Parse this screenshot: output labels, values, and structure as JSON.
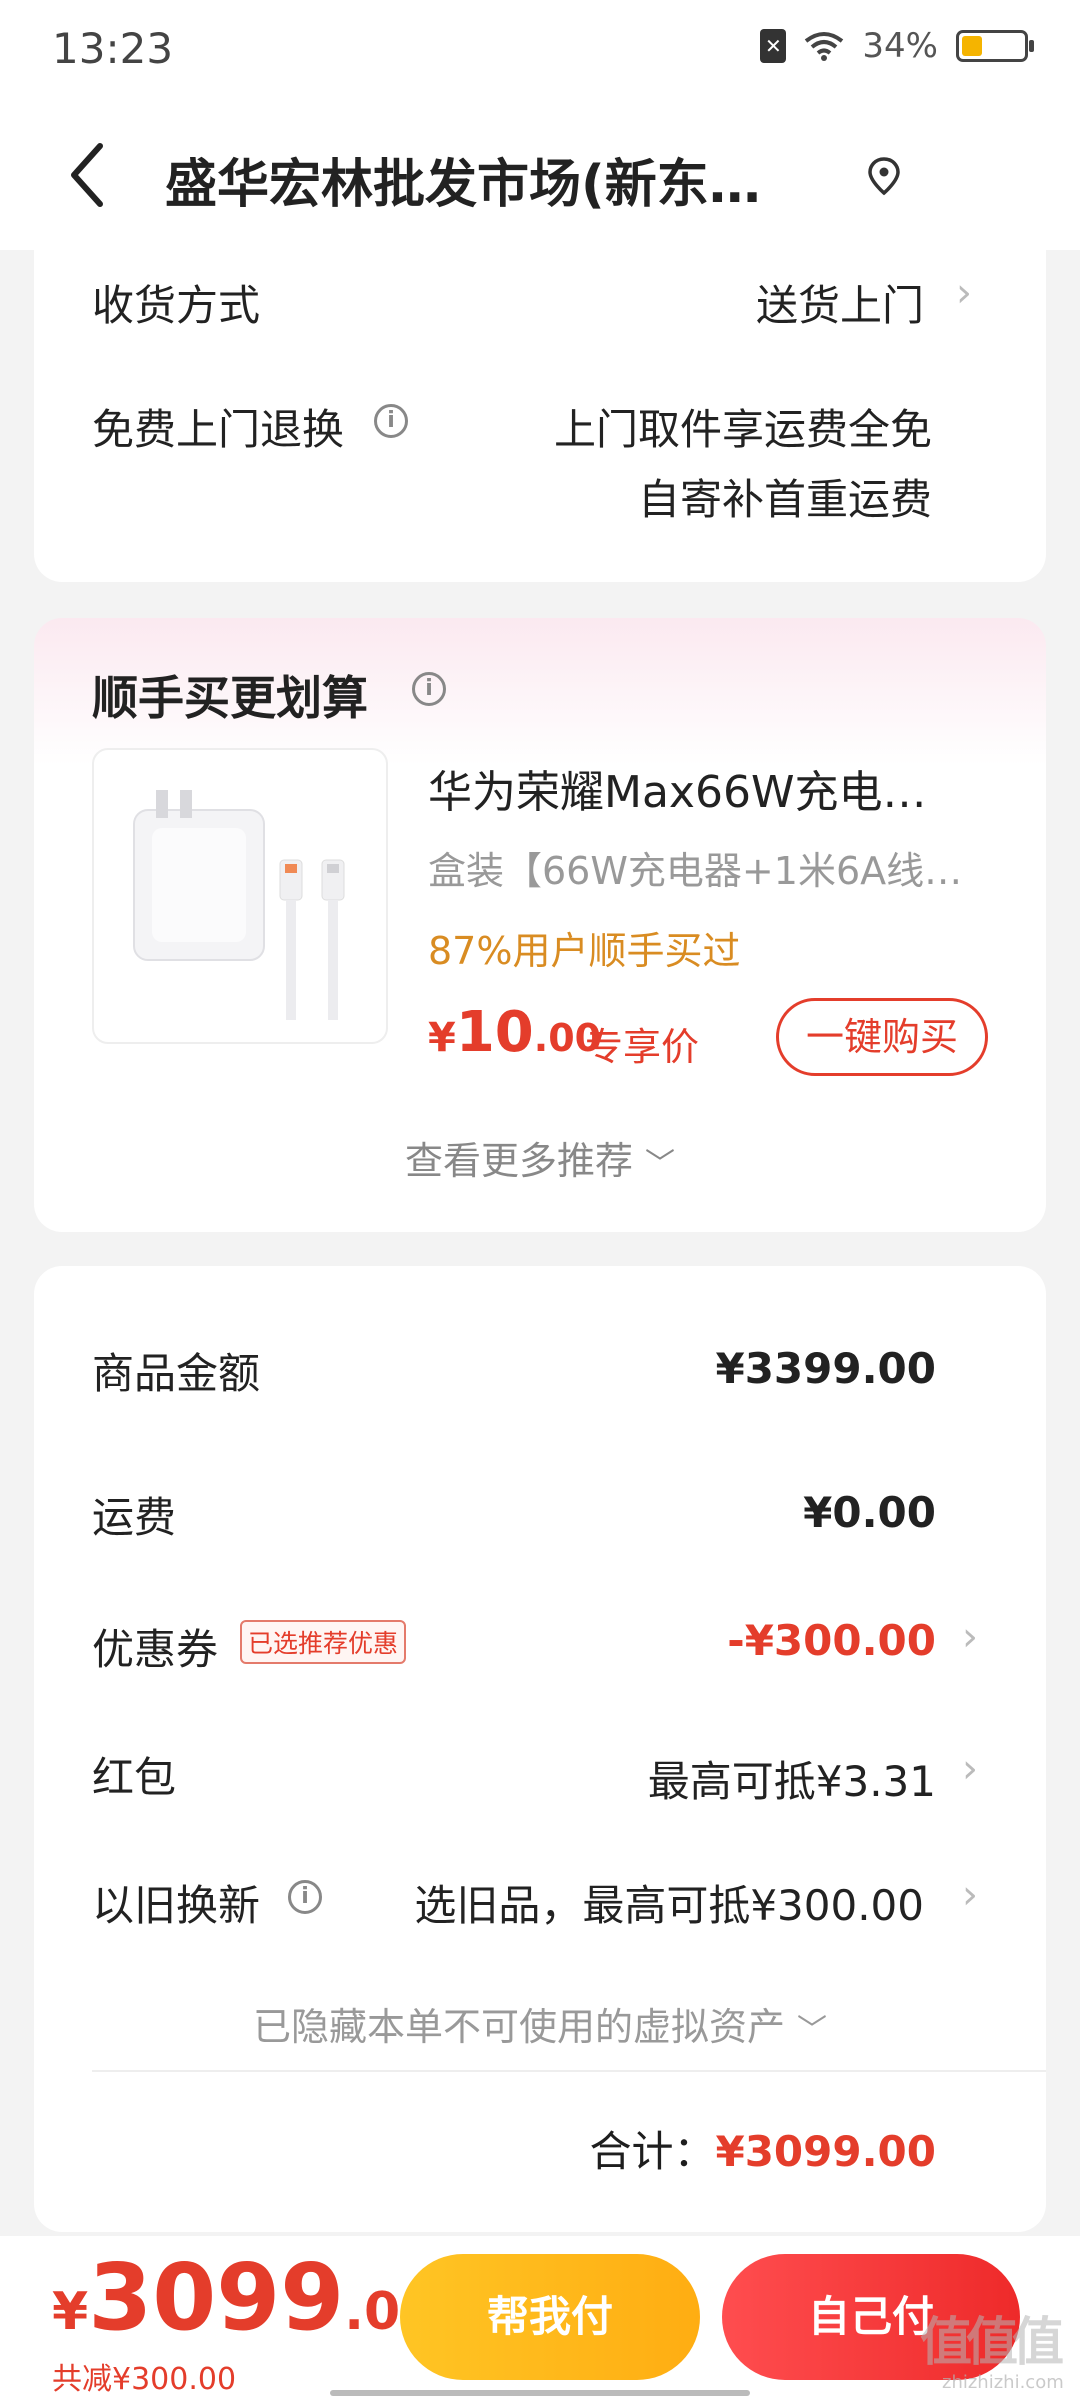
{
  "status_bar": {
    "time": "13:23",
    "battery": "34%",
    "battery_level": 0.34
  },
  "header": {
    "title": "盛华宏林批发市场(新东…"
  },
  "delivery": {
    "method_label": "收货方式",
    "method_value": "送货上门",
    "return_label": "免费上门退换",
    "return_line1": "上门取件享运费全免",
    "return_line2": "自寄补首重运费"
  },
  "bundle": {
    "title": "顺手买更划算",
    "product_name": "华为荣耀Max66W充电…",
    "product_spec": "盒装【66W充电器+1米6A线…",
    "product_stat": "87%用户顺手买过",
    "price_symbol": "¥",
    "price_int": "10",
    "price_dec": ".00",
    "price_tag": "专享价",
    "buy_label": "一键购买",
    "more_label": "查看更多推荐"
  },
  "summary": {
    "goods_label": "商品金额",
    "goods_value": "¥3399.00",
    "shipping_label": "运费",
    "shipping_value": "¥0.00",
    "coupon_label": "优惠券",
    "coupon_tag": "已选推荐优惠",
    "coupon_value": "-¥300.00",
    "redpacket_label": "红包",
    "redpacket_value": "最高可抵¥3.31",
    "tradein_label": "以旧换新",
    "tradein_value": "选旧品，最高可抵¥300.00",
    "hidden_label": "已隐藏本单不可使用的虚拟资产",
    "total_label": "合计：",
    "total_value": "¥3099.00"
  },
  "bottom": {
    "symbol": "¥",
    "amount_int": "3099",
    "amount_dec": ".00",
    "saved": "共减¥300.00",
    "help_pay": "帮我付",
    "self_pay": "自己付",
    "watermark": "值值值",
    "watermark_sub": "zhizhizhi.com"
  },
  "colors": {
    "accent_red": "#e43d2b",
    "orange_text": "#d98c22",
    "yellow_button": "#ffb81c"
  }
}
